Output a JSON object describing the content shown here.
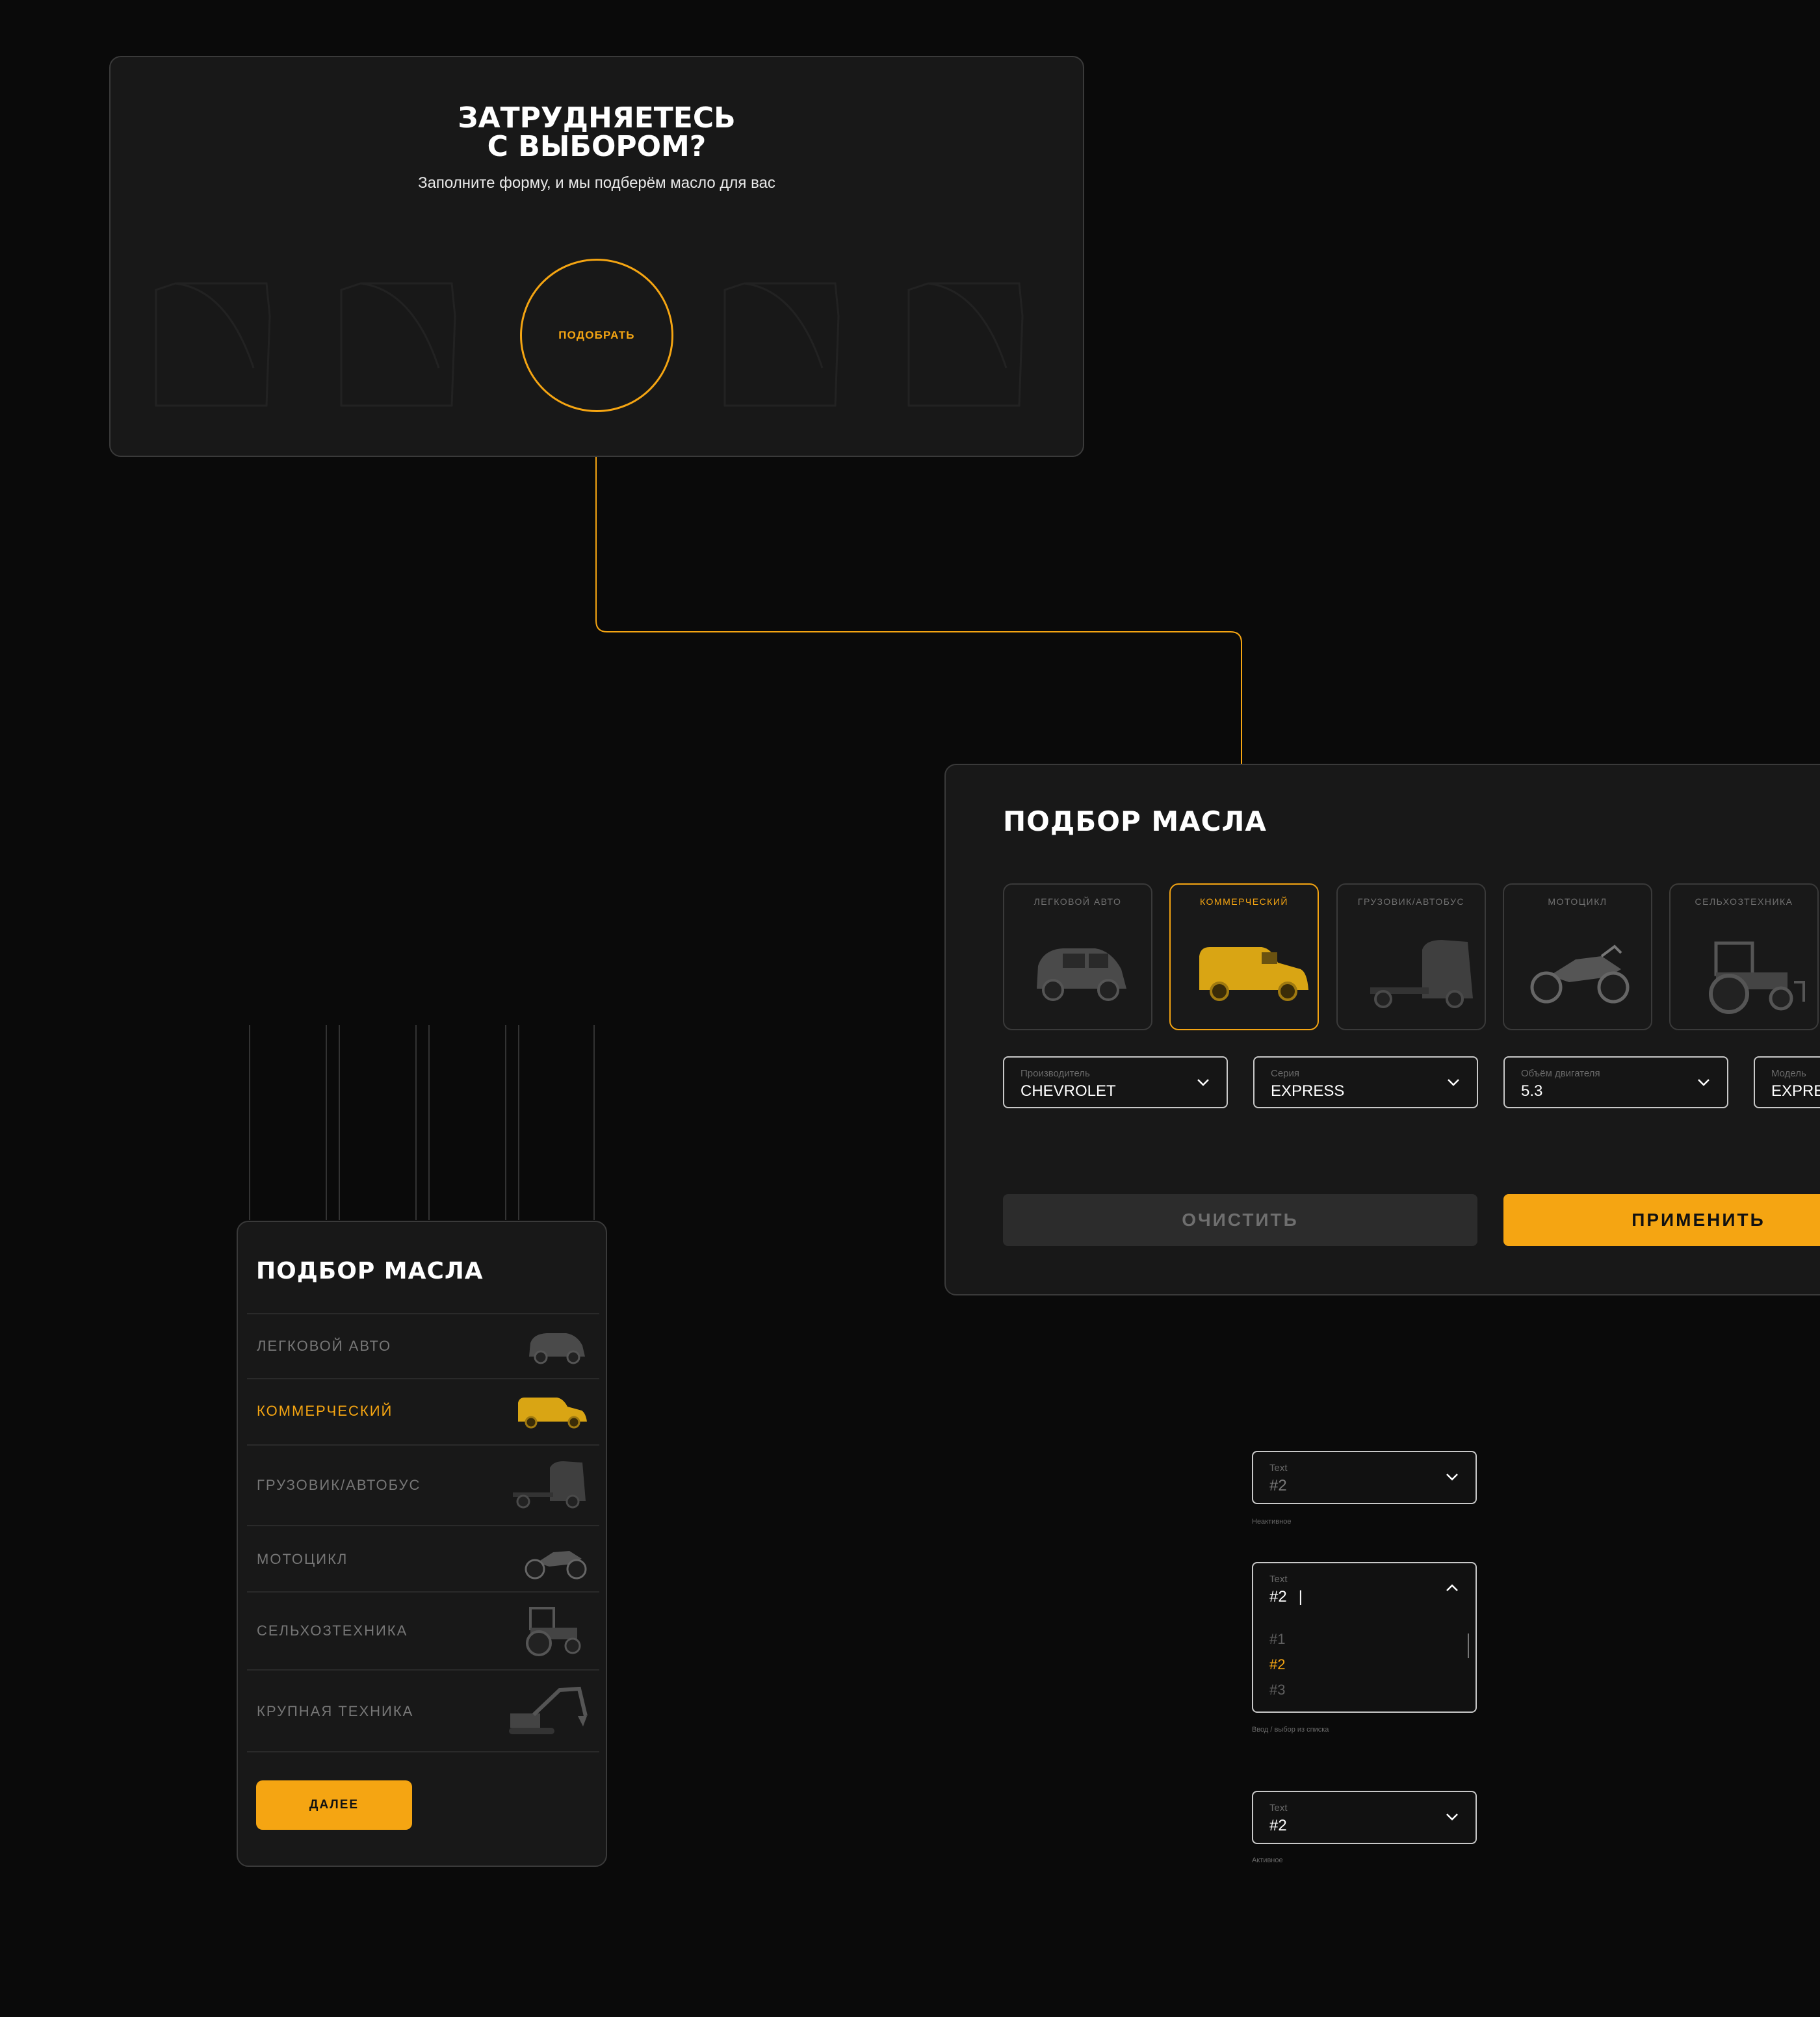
{
  "promo": {
    "title_line1": "ЗАТРУДНЯЕТЕСЬ",
    "title_line2": "С ВЫБОРОМ?",
    "subtitle": "Заполните форму, и мы подберём масло для вас",
    "button": "ПОДОБРАТЬ"
  },
  "desktop": {
    "title": "ПОДБОР МАСЛА",
    "vehicles": [
      {
        "label": "ЛЕГКОВОЙ АВТО",
        "icon": "car-icon",
        "active": false
      },
      {
        "label": "КОММЕРЧЕСКИЙ",
        "icon": "van-icon",
        "active": true
      },
      {
        "label": "ГРУЗОВИК/АВТОБУС",
        "icon": "truck-icon",
        "active": false
      },
      {
        "label": "МОТОЦИКЛ",
        "icon": "motorcycle-icon",
        "active": false
      },
      {
        "label": "СЕЛЬХОЗТЕХНИКА",
        "icon": "tractor-icon",
        "active": false
      }
    ],
    "selects": [
      {
        "caption": "Производитель",
        "value": "CHEVROLET"
      },
      {
        "caption": "Серия",
        "value": "EXPRESS"
      },
      {
        "caption": "Объём двигателя",
        "value": "5.3"
      },
      {
        "caption": "Модель",
        "value": "EXPRE"
      }
    ],
    "clear_label": "ОЧИСТИТЬ",
    "apply_label": "ПРИМЕНИТЬ"
  },
  "mobile": {
    "title": "ПОДБОР МАСЛА",
    "items": [
      {
        "label": "ЛЕГКОВОЙ АВТО",
        "icon": "car-icon",
        "active": false
      },
      {
        "label": "КОММЕРЧЕСКИЙ",
        "icon": "van-icon",
        "active": true
      },
      {
        "label": "ГРУЗОВИК/АВТОБУС",
        "icon": "truck-icon",
        "active": false
      },
      {
        "label": "МОТОЦИКЛ",
        "icon": "motorcycle-icon",
        "active": false
      },
      {
        "label": "СЕЛЬХОЗТЕХНИКА",
        "icon": "tractor-icon",
        "active": false
      },
      {
        "label": "КРУПНАЯ ТЕХНИКА",
        "icon": "excavator-icon",
        "active": false
      }
    ],
    "next_label": "ДАЛЕЕ"
  },
  "dropdowns": {
    "inactive": {
      "caption": "Text",
      "value": "#2",
      "note": "Неактивное"
    },
    "open": {
      "caption": "Text",
      "value": "#2",
      "options": [
        "#1",
        "#2",
        "#3"
      ],
      "selected": "#2",
      "note": "Ввод / выбор из списка"
    },
    "active": {
      "caption": "Text",
      "value": "#2",
      "note": "Активное"
    }
  },
  "colors": {
    "accent": "#f5a512",
    "background": "#0a0a0a",
    "card": "#181818"
  }
}
